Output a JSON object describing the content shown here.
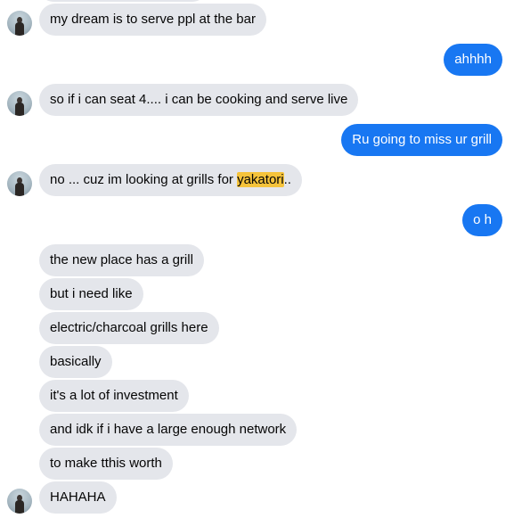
{
  "messages": {
    "m1": "my dream is to serve ppl at the bar",
    "m2": "ahhhh",
    "m3": "so if i can seat 4.... i can be cooking and serve live",
    "m4": "Ru going to miss ur grill",
    "m5_before": "no ... cuz im looking at grills for ",
    "m5_highlight": "yakatori",
    "m5_after": "..",
    "m6": "o h",
    "m7": "the new place has a grill",
    "m8": "but i need like",
    "m9": "electric/charcoal grills here",
    "m10": "basically",
    "m11": "it's a lot of investment",
    "m12": "and idk if i have a large enough network",
    "m13": "to make tthis worth",
    "m14": "HAHAHA"
  },
  "colors": {
    "incoming_bubble": "#e4e6eb",
    "outgoing_bubble": "#1877f2",
    "search_highlight": "#f5c33b"
  },
  "icons": {
    "avatar": "contact-avatar"
  }
}
